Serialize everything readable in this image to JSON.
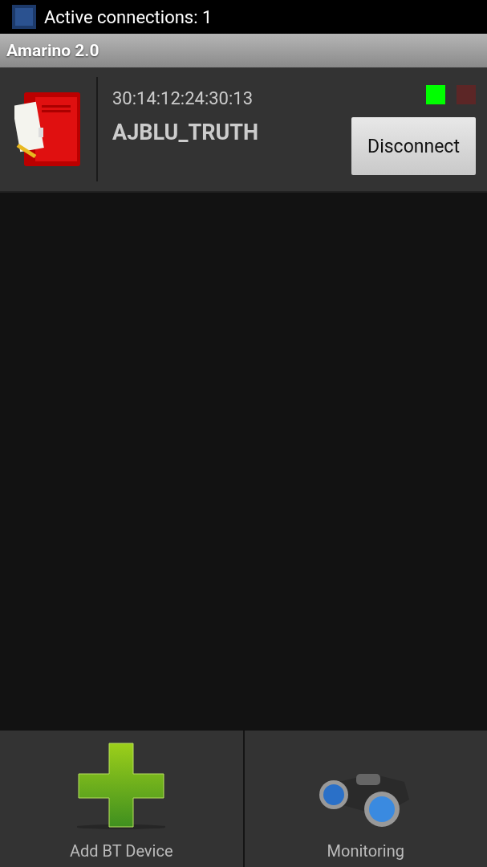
{
  "status_bar": {
    "text": "Active connections: 1"
  },
  "title_bar": {
    "title": "Amarino 2.0"
  },
  "devices": [
    {
      "address": "30:14:12:24:30:13",
      "name": "AJBLU_TRUTH",
      "indicators": [
        {
          "color": "#00ff00"
        },
        {
          "color": "#5c2626"
        }
      ],
      "button": "Disconnect"
    }
  ],
  "actions": [
    {
      "kind": "add",
      "label": "Add BT Device"
    },
    {
      "kind": "monitor",
      "label": "Monitoring"
    }
  ]
}
